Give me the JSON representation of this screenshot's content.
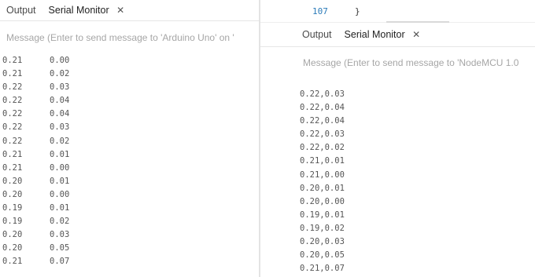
{
  "left_panel": {
    "tabs": {
      "output": "Output",
      "serial_monitor": "Serial Monitor",
      "close": "✕"
    },
    "message_placeholder": "Message (Enter to send message to 'Arduino Uno' on '",
    "rows": [
      [
        "0.21",
        "0.00"
      ],
      [
        "0.21",
        "0.02"
      ],
      [
        "0.22",
        "0.03"
      ],
      [
        "0.22",
        "0.04"
      ],
      [
        "0.22",
        "0.04"
      ],
      [
        "0.22",
        "0.03"
      ],
      [
        "0.22",
        "0.02"
      ],
      [
        "0.21",
        "0.01"
      ],
      [
        "0.21",
        "0.00"
      ],
      [
        "0.20",
        "0.01"
      ],
      [
        "0.20",
        "0.00"
      ],
      [
        "0.19",
        "0.01"
      ],
      [
        "0.19",
        "0.02"
      ],
      [
        "0.20",
        "0.03"
      ],
      [
        "0.20",
        "0.05"
      ],
      [
        "0.21",
        "0.07"
      ]
    ]
  },
  "right_panel": {
    "code_line": {
      "number": "107",
      "text": "}"
    },
    "tabs": {
      "output": "Output",
      "serial_monitor": "Serial Monitor",
      "close": "✕"
    },
    "message_placeholder": "Message (Enter to send message to 'NodeMCU 1.0",
    "lines": [
      "0.22,0.03",
      "0.22,0.04",
      "0.22,0.04",
      "0.22,0.03",
      "0.22,0.02",
      "0.21,0.01",
      "0.21,0.00",
      "0.20,0.01",
      "0.20,0.00",
      "0.19,0.01",
      "0.19,0.02",
      "0.20,0.03",
      "0.20,0.05",
      "0.21,0.07"
    ]
  }
}
